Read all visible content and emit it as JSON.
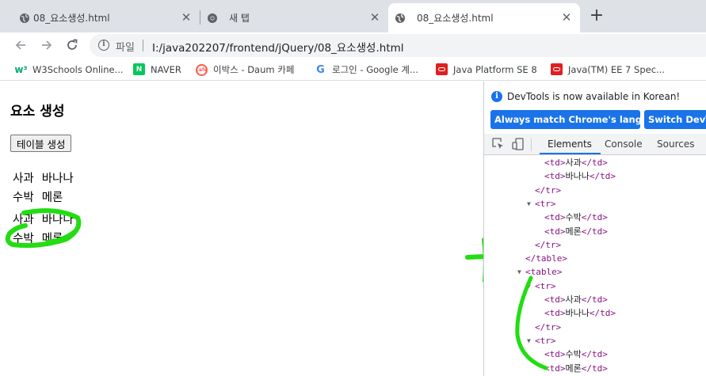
{
  "browser": {
    "tabs": [
      {
        "title": "08_요소생성.html",
        "icon": "globe-icon",
        "close": "✕",
        "active": false
      },
      {
        "title": "새 탭",
        "icon": "chrome-icon",
        "close": "✕",
        "active": false
      },
      {
        "title": "08_요소생성.html",
        "icon": "globe-icon",
        "close": "✕",
        "active": true
      }
    ],
    "new_tab_label": "+",
    "address": {
      "scheme_label": "파일",
      "url": "I:/java202207/frontend/jQuery/08_요소생성.html"
    },
    "bookmarks": [
      {
        "label": "W3Schools Online...",
        "icon": "w3schools-icon",
        "color": "#04aa6d"
      },
      {
        "label": "NAVER",
        "icon": "naver-icon",
        "color": "#03c75a"
      },
      {
        "label": "이박스 - Daum 카페",
        "icon": "daum-cafe-icon",
        "color": "#ff5a4a"
      },
      {
        "label": "로그인 - Google 계...",
        "icon": "google-icon",
        "color": "#4285f4"
      },
      {
        "label": "Java Platform SE 8",
        "icon": "oracle-icon",
        "color": "#e02020"
      },
      {
        "label": "Java(TM) EE 7 Spec...",
        "icon": "oracle-icon",
        "color": "#e02020"
      }
    ]
  },
  "page": {
    "title": "요소 생성",
    "button_label": "테이블 생성",
    "tables": [
      {
        "rows": [
          [
            "사과",
            "바나나"
          ],
          [
            "수박",
            "메론"
          ]
        ]
      },
      {
        "rows": [
          [
            "사과",
            "바나나"
          ],
          [
            "수박",
            "메론"
          ]
        ]
      }
    ]
  },
  "devtools": {
    "notice": "DevTools is now available in Korean!",
    "buttons": [
      "Always match Chrome's language",
      "Switch DevTools"
    ],
    "tabs": [
      "Elements",
      "Console",
      "Sources"
    ],
    "active_tab": "Elements",
    "tree": [
      {
        "indent": 3,
        "open": "<td>",
        "text": "사과",
        "close": "</td>"
      },
      {
        "indent": 3,
        "open": "<td>",
        "text": "바나나",
        "close": "</td>"
      },
      {
        "indent": 2,
        "open": "</tr>",
        "text": "",
        "close": ""
      },
      {
        "indent": 2,
        "open": "<tr>",
        "text": "",
        "close": "",
        "triangle": true
      },
      {
        "indent": 3,
        "open": "<td>",
        "text": "수박",
        "close": "</td>"
      },
      {
        "indent": 3,
        "open": "<td>",
        "text": "메론",
        "close": "</td>"
      },
      {
        "indent": 2,
        "open": "</tr>",
        "text": "",
        "close": ""
      },
      {
        "indent": 1,
        "open": "</table>",
        "text": "",
        "close": ""
      },
      {
        "indent": 1,
        "open": "<table>",
        "text": "",
        "close": "",
        "triangle": true
      },
      {
        "indent": 2,
        "open": "<tr>",
        "text": "",
        "close": "",
        "triangle": true
      },
      {
        "indent": 3,
        "open": "<td>",
        "text": "사과",
        "close": "</td>"
      },
      {
        "indent": 3,
        "open": "<td>",
        "text": "바나나",
        "close": "</td>"
      },
      {
        "indent": 2,
        "open": "</tr>",
        "text": "",
        "close": ""
      },
      {
        "indent": 2,
        "open": "<tr>",
        "text": "",
        "close": "",
        "triangle": true
      },
      {
        "indent": 3,
        "open": "<td>",
        "text": "수박",
        "close": "</td>"
      },
      {
        "indent": 3,
        "open": "<td>",
        "text": "메론",
        "close": "</td>"
      }
    ]
  },
  "annotations": {
    "color": "#22dd11"
  }
}
